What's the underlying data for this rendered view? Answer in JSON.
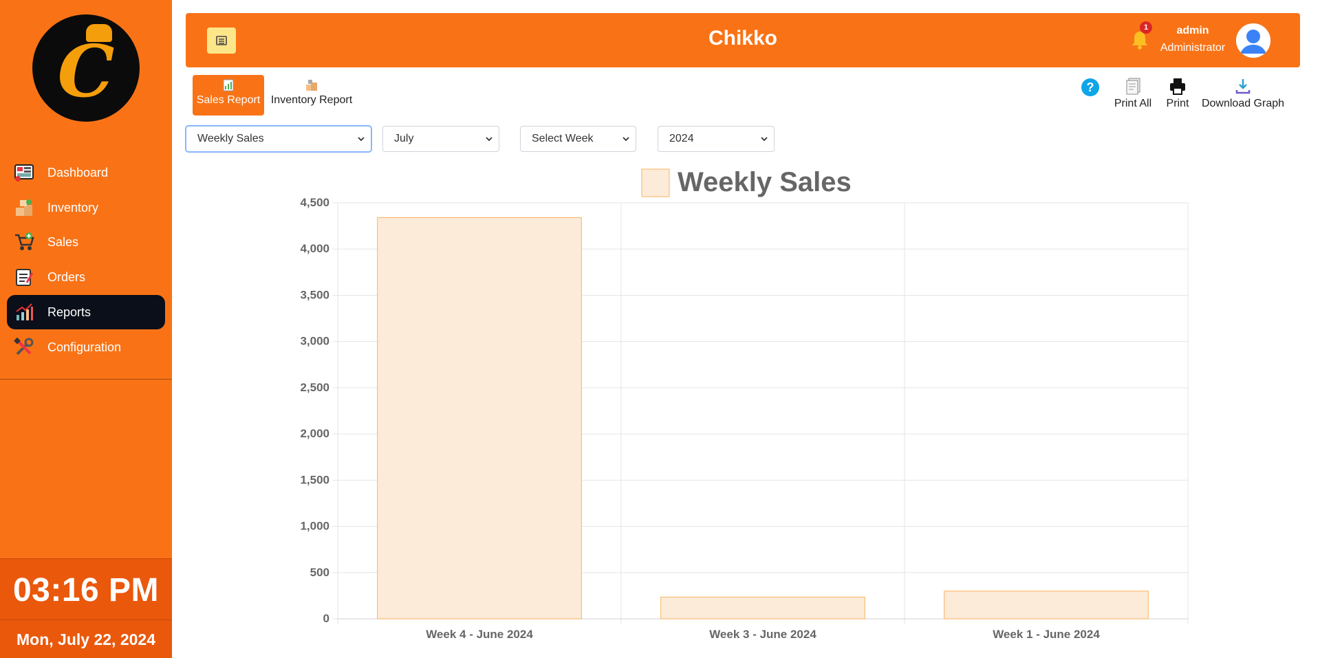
{
  "sidebar": {
    "logo_letter": "C",
    "items": [
      {
        "label": "Dashboard",
        "icon": "dashboard-icon",
        "active": false
      },
      {
        "label": "Inventory",
        "icon": "inventory-icon",
        "active": false
      },
      {
        "label": "Sales",
        "icon": "cart-icon",
        "active": false
      },
      {
        "label": "Orders",
        "icon": "orders-icon",
        "active": false
      },
      {
        "label": "Reports",
        "icon": "reports-icon",
        "active": true
      },
      {
        "label": "Configuration",
        "icon": "tools-icon",
        "active": false
      }
    ],
    "time": "03:16 PM",
    "date": "Mon, July 22, 2024"
  },
  "header": {
    "title": "Chikko",
    "notification_count": "1",
    "user_name": "admin",
    "user_role": "Administrator"
  },
  "tabs": [
    {
      "label": "Sales Report",
      "active": true
    },
    {
      "label": "Inventory Report",
      "active": false
    }
  ],
  "actions": {
    "print_all": "Print All",
    "print": "Print",
    "download": "Download Graph",
    "help": "?"
  },
  "filters": {
    "report_type": "Weekly Sales",
    "month": "July",
    "week": "Select Week",
    "year": "2024"
  },
  "colors": {
    "brand": "#f97316",
    "sidebar_active": "#0a0f1a",
    "bar_fill": "#fdebd9",
    "bar_border": "#fbb25e"
  },
  "chart_data": {
    "type": "bar",
    "categories": [
      "Week 4 - June 2024",
      "Week 3 - June 2024",
      "Week 1 - June 2024"
    ],
    "series": [
      {
        "name": "Weekly Sales",
        "values": [
          4340,
          235,
          300
        ]
      }
    ],
    "ylim": [
      0,
      4500
    ],
    "yticks": [
      "0",
      "500",
      "1,000",
      "1,500",
      "2,000",
      "2,500",
      "3,000",
      "3,500",
      "4,000",
      "4,500"
    ],
    "grid": true,
    "legend": "top-center"
  }
}
